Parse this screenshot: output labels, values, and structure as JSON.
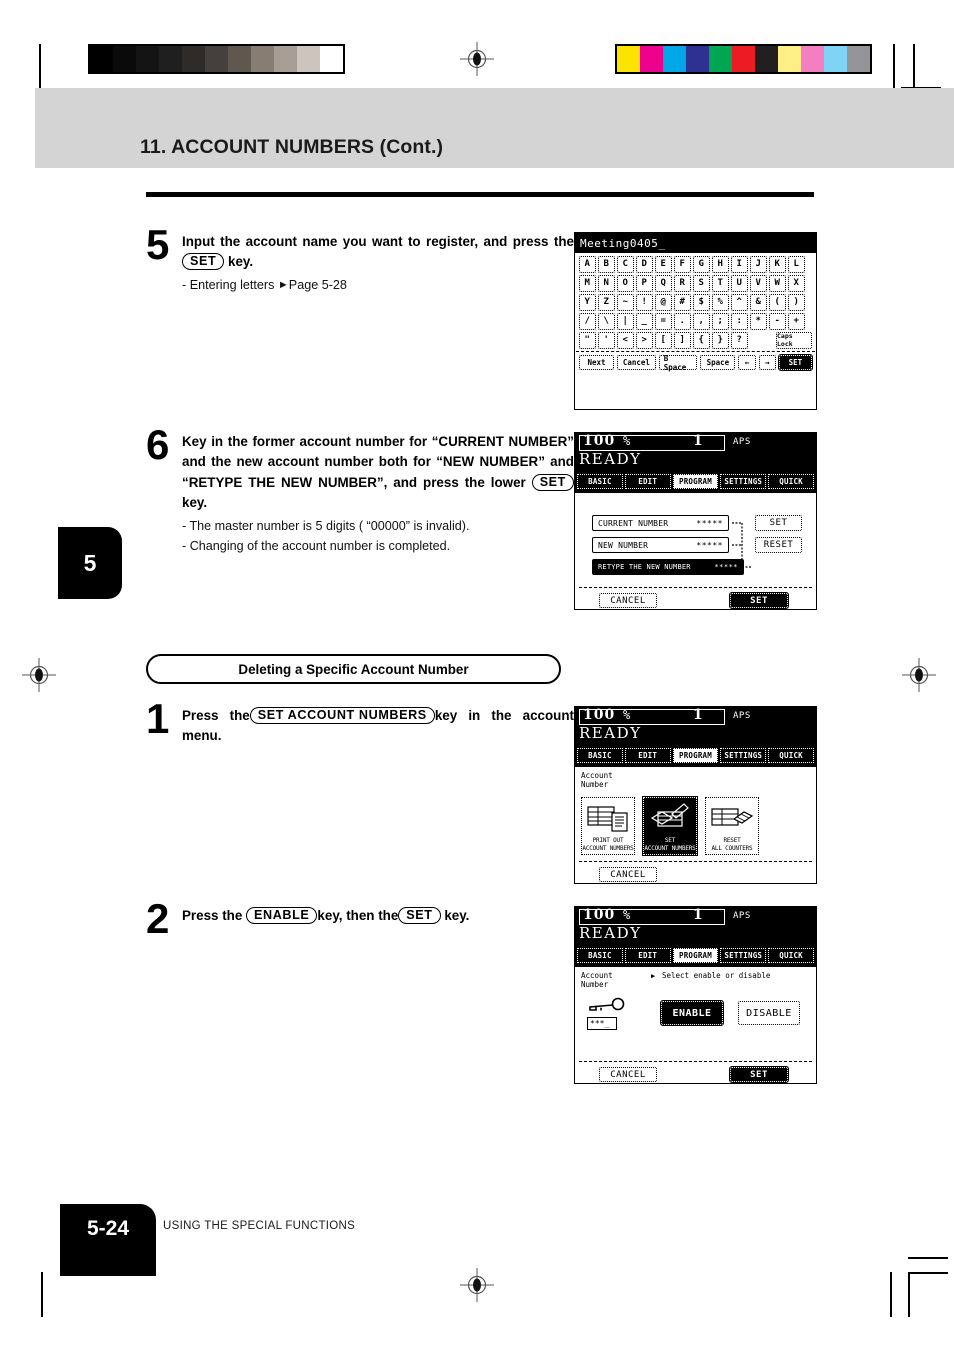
{
  "header": {
    "title": "11. ACCOUNT NUMBERS (Cont.)"
  },
  "chapter_tab": "5",
  "footer": {
    "page_number": "5-24",
    "running_head": "USING THE SPECIAL FUNCTIONS"
  },
  "calibration": {
    "grayscale_swatches": [
      "#000000",
      "#0a0a0a",
      "#141414",
      "#1f1f1f",
      "#2e2b29",
      "#46403c",
      "#60584f",
      "#877d73",
      "#a79d94",
      "#cdc5bd",
      "#ffffff"
    ],
    "color_swatches": [
      "#fbe400",
      "#ec008c",
      "#00a7e7",
      "#2e3192",
      "#00a651",
      "#ed1c24",
      "#231f20",
      "#fdef86",
      "#f47fc0",
      "#7fd4f5",
      "#939598"
    ]
  },
  "steps": [
    {
      "number": "5",
      "title_parts": [
        {
          "t": "text",
          "v": "Input the account name you want to register, and press the"
        },
        {
          "t": "key",
          "v": "SET"
        },
        {
          "t": "text",
          "v": "key."
        }
      ],
      "notes": [
        {
          "prefix": "- ",
          "text": "Entering letters ",
          "arrow": "►",
          "suffix": "Page 5-28"
        }
      ]
    },
    {
      "number": "6",
      "title_parts": [
        {
          "t": "text",
          "v": "Key in the former account number for “CURRENT NUMBER” and the new account number both for “NEW NUMBER” and “RETYPE THE NEW NUMBER”, and press the lower"
        },
        {
          "t": "key",
          "v": "SET"
        },
        {
          "t": "text",
          "v": "key."
        }
      ],
      "notes": [
        {
          "prefix": "- ",
          "text": "The master number is 5 digits ( “00000” is invalid)."
        },
        {
          "prefix": "- ",
          "text": "Changing of the account number is completed."
        }
      ]
    }
  ],
  "section": {
    "heading": "Deleting a Specific Account Number"
  },
  "delete_steps": [
    {
      "number": "1",
      "title_parts": [
        {
          "t": "text",
          "v": "Press the"
        },
        {
          "t": "key",
          "v": "SET ACCOUNT NUMBERS"
        },
        {
          "t": "text",
          "v": "key in the account menu."
        }
      ],
      "notes": []
    },
    {
      "number": "2",
      "title_parts": [
        {
          "t": "text",
          "v": "Press the"
        },
        {
          "t": "key",
          "v": "ENABLE"
        },
        {
          "t": "text",
          "v": "key, then the"
        },
        {
          "t": "key2",
          "v": "SET"
        },
        {
          "t": "text",
          "v": "key."
        }
      ],
      "notes": []
    }
  ],
  "lcd_keyboard": {
    "display_text": "Meeting0405_",
    "rows": [
      [
        "A",
        "B",
        "C",
        "D",
        "E",
        "F",
        "G",
        "H",
        "I",
        "J",
        "K",
        "L"
      ],
      [
        "M",
        "N",
        "O",
        "P",
        "Q",
        "R",
        "S",
        "T",
        "U",
        "V",
        "W",
        "X"
      ],
      [
        "Y",
        "Z",
        "~",
        "!",
        "@",
        "#",
        "$",
        "%",
        "^",
        "&",
        "(",
        ")"
      ],
      [
        "/",
        "\\",
        "|",
        "_",
        "=",
        ".",
        ",",
        ";",
        ":",
        "*",
        "-",
        "+"
      ],
      [
        "\"",
        "'",
        "<",
        ">",
        "[",
        "]",
        "{",
        "}",
        "?"
      ]
    ],
    "caps_lock_label": "Caps Lock",
    "bottom_keys": [
      "Next",
      "Cancel",
      "B Space",
      "Space",
      "←",
      "→",
      "SET"
    ],
    "bottom_set_label": "SET"
  },
  "lcd_status": {
    "zoom": "100",
    "percent": "%",
    "copies": "1",
    "paper_mode": "APS",
    "state": "READY",
    "tabs": [
      "BASIC",
      "EDIT",
      "PROGRAM",
      "SETTINGS",
      "QUICK"
    ],
    "active_tab": "PROGRAM"
  },
  "lcd_change_number": {
    "fields": [
      {
        "label": "CURRENT NUMBER",
        "value": "*****",
        "inverted": false
      },
      {
        "label": "NEW NUMBER",
        "value": "*****",
        "inverted": false
      },
      {
        "label": "RETYPE THE NEW NUMBER",
        "value": "*****",
        "inverted": true
      }
    ],
    "side_buttons": [
      "SET",
      "RESET"
    ],
    "cancel_label": "CANCEL",
    "set_label": "SET"
  },
  "lcd_account_menu": {
    "menu_title_line1": "Account",
    "menu_title_line2": "Number",
    "tiles": [
      {
        "icon": "print-out-icon",
        "line1": "PRINT OUT",
        "line2": "ACCOUNT NUMBERS",
        "selected": false
      },
      {
        "icon": "set-account-icon",
        "line1": "SET",
        "line2": "ACCOUNT NUMBERS",
        "selected": true
      },
      {
        "icon": "reset-counters-icon",
        "line1": "RESET",
        "line2": "ALL COUNTERS",
        "selected": false
      }
    ],
    "cancel_label": "CANCEL"
  },
  "lcd_enable_disable": {
    "menu_title_line1": "Account",
    "menu_title_line2": "Number",
    "prompt_arrow": "▶",
    "prompt": "Select enable or disable",
    "pin_value": "***_",
    "enable_label": "ENABLE",
    "disable_label": "DISABLE",
    "enable_selected": true,
    "cancel_label": "CANCEL",
    "set_label": "SET"
  }
}
